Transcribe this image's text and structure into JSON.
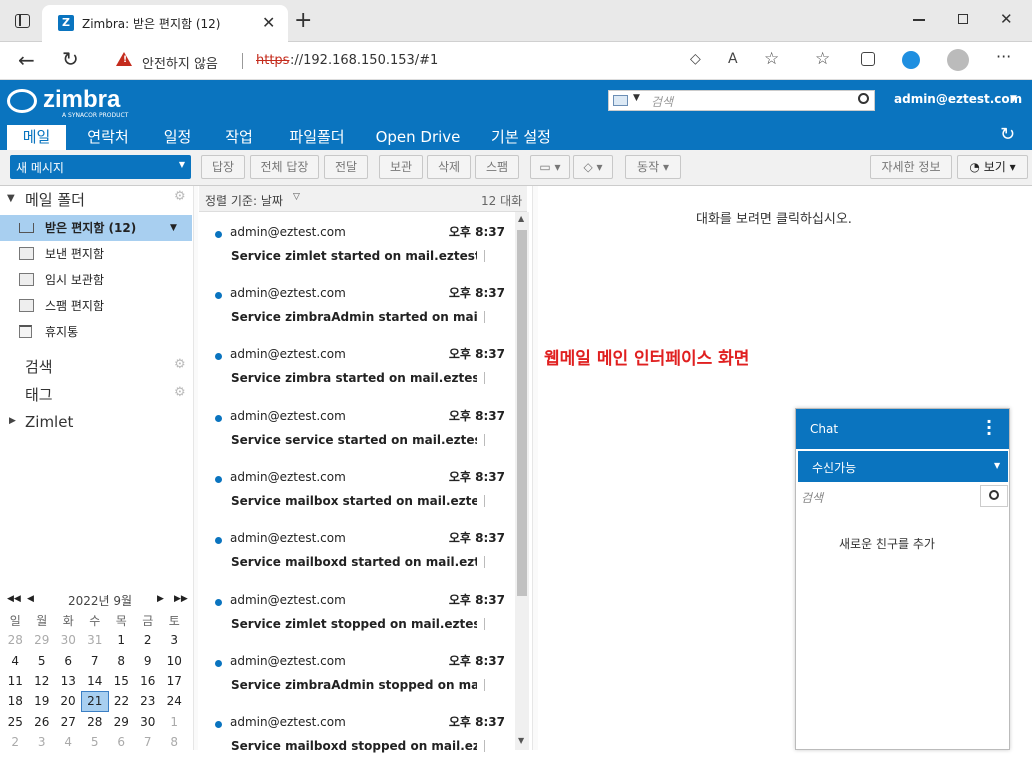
{
  "browser": {
    "tab_title": "Zimbra: 받은 편지함 (12)",
    "security_label": "안전하지 않음",
    "url_scheme": "https",
    "url_rest": "://192.168.150.153/#1"
  },
  "header": {
    "logo": "zimbra",
    "logo_sub": "A SYNACOR PRODUCT",
    "search_placeholder": "검색",
    "user": "admin@eztest.com"
  },
  "nav": {
    "tabs": [
      "메일",
      "연락처",
      "일정",
      "작업",
      "파일폴더",
      "Open Drive",
      "기본 설정"
    ]
  },
  "toolbar": {
    "new_message": "새 메시지",
    "reply": "답장",
    "reply_all": "전체 답장",
    "forward": "전달",
    "archive": "보관",
    "delete": "삭제",
    "spam": "스팸",
    "actions": "동작",
    "details": "자세한 정보",
    "view": "보기"
  },
  "sidebar": {
    "mail_folders_title": "메일 폴더",
    "folders": [
      {
        "label": "받은 편지함 (12)"
      },
      {
        "label": "보낸 편지함"
      },
      {
        "label": "임시 보관함"
      },
      {
        "label": "스팸 편지함"
      },
      {
        "label": "휴지통"
      }
    ],
    "search": "검색",
    "tags": "태그",
    "zimlet": "Zimlet"
  },
  "calendar": {
    "title": "2022년 9월",
    "weekdays": [
      "일",
      "월",
      "화",
      "수",
      "목",
      "금",
      "토"
    ],
    "weeks": [
      [
        "28",
        "29",
        "30",
        "31",
        "1",
        "2",
        "3"
      ],
      [
        "4",
        "5",
        "6",
        "7",
        "8",
        "9",
        "10"
      ],
      [
        "11",
        "12",
        "13",
        "14",
        "15",
        "16",
        "17"
      ],
      [
        "18",
        "19",
        "20",
        "21",
        "22",
        "23",
        "24"
      ],
      [
        "25",
        "26",
        "27",
        "28",
        "29",
        "30",
        "1"
      ],
      [
        "2",
        "3",
        "4",
        "5",
        "6",
        "7",
        "8"
      ]
    ]
  },
  "list": {
    "sort_label": "정렬 기준: 날짜",
    "count": "12 대화",
    "messages": [
      {
        "from": "admin@eztest.com",
        "time": "오후 8:37",
        "subject": "Service zimlet started on mail.eztest.com - S"
      },
      {
        "from": "admin@eztest.com",
        "time": "오후 8:37",
        "subject": "Service zimbraAdmin started on mail.eztest"
      },
      {
        "from": "admin@eztest.com",
        "time": "오후 8:37",
        "subject": "Service zimbra started on mail.eztest.com - S"
      },
      {
        "from": "admin@eztest.com",
        "time": "오후 8:37",
        "subject": "Service service started on mail.eztest.com -"
      },
      {
        "from": "admin@eztest.com",
        "time": "오후 8:37",
        "subject": "Service mailbox started on mail.eztest.com -"
      },
      {
        "from": "admin@eztest.com",
        "time": "오후 8:37",
        "subject": "Service mailboxd started on mail.eztest.com"
      },
      {
        "from": "admin@eztest.com",
        "time": "오후 8:37",
        "subject": "Service zimlet stopped on mail.eztest.com -"
      },
      {
        "from": "admin@eztest.com",
        "time": "오후 8:37",
        "subject": "Service zimbraAdmin stopped on mail.eztes"
      },
      {
        "from": "admin@eztest.com",
        "time": "오후 8:37",
        "subject": "Service mailboxd stopped on mail.eztest.co"
      }
    ]
  },
  "reading": {
    "hint": "대화를 보려면 클릭하십시오.",
    "annotation": "웹메일 메인 인터페이스 화면"
  },
  "chat": {
    "title": "Chat",
    "status": "수신가능",
    "search_placeholder": "검색",
    "add_buddy": "새로운 친구를 추가"
  },
  "colors": {
    "brand": "#0a74bf",
    "annotation": "#e02020"
  }
}
